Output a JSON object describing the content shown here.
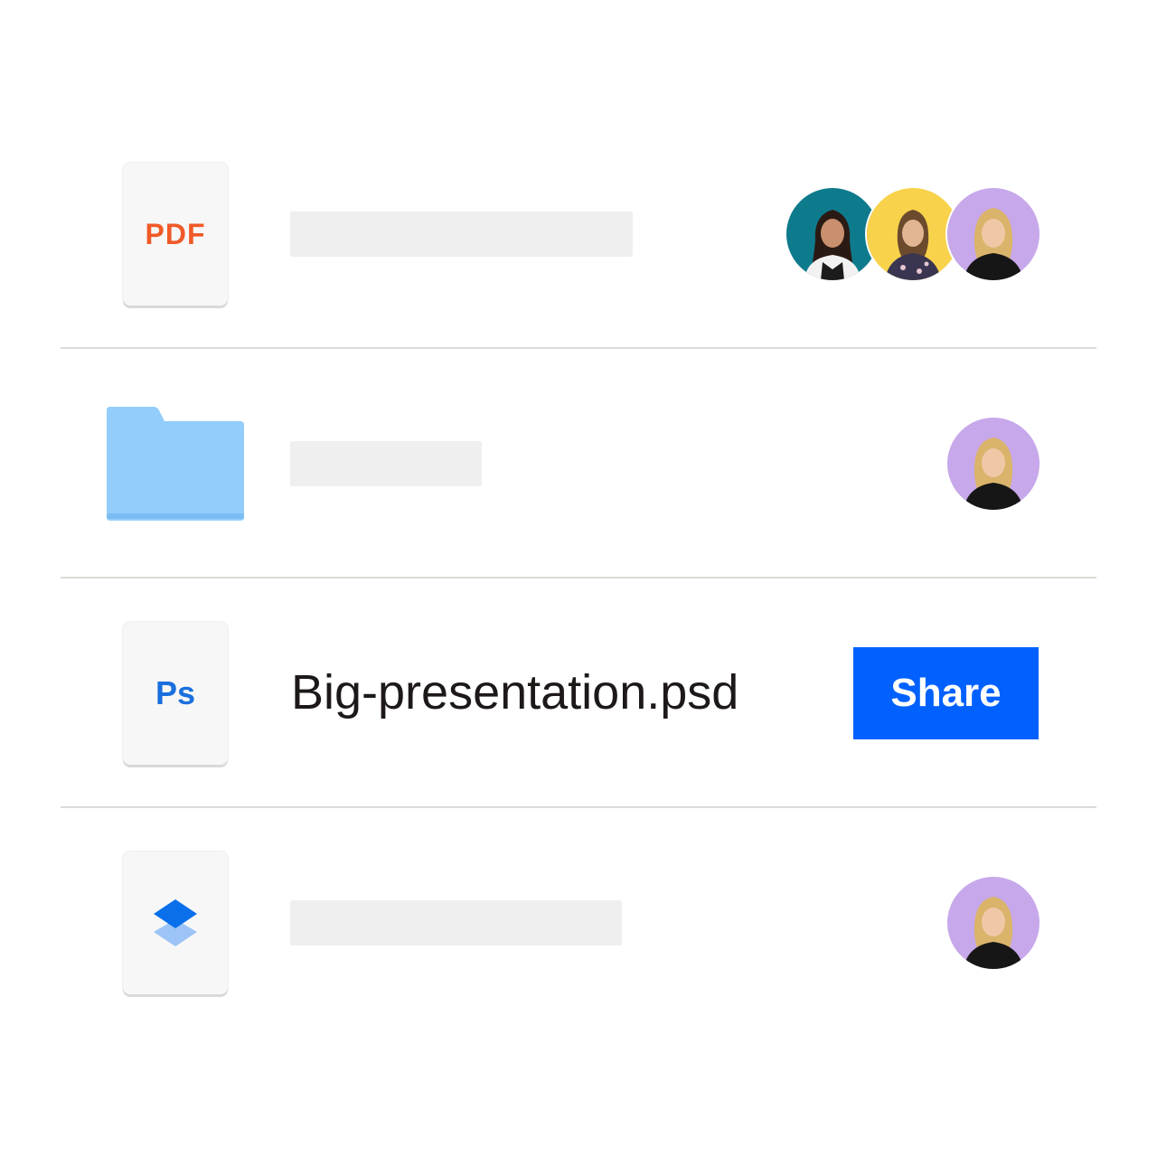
{
  "colors": {
    "accent": "#0061fe",
    "pdf": "#f05a28",
    "ps": "#1a6fdd",
    "folder": "#92cdfc",
    "folder_tab": "#8fcaf9",
    "avatar_teal": "#0e7b8d",
    "avatar_yellow": "#f8d24a",
    "avatar_lavender": "#c7a8ea"
  },
  "files": [
    {
      "icon": "pdf-file-icon",
      "label": "PDF",
      "name": "",
      "shared_with": [
        "avatar-teal",
        "avatar-yellow",
        "avatar-lavender"
      ]
    },
    {
      "icon": "folder-icon",
      "name": "",
      "shared_with": [
        "avatar-lavender"
      ]
    },
    {
      "icon": "photoshop-file-icon",
      "label": "Ps",
      "name": "Big-presentation.psd",
      "action": "Share"
    },
    {
      "icon": "layers-file-icon",
      "name": "",
      "shared_with": [
        "avatar-lavender"
      ]
    }
  ]
}
